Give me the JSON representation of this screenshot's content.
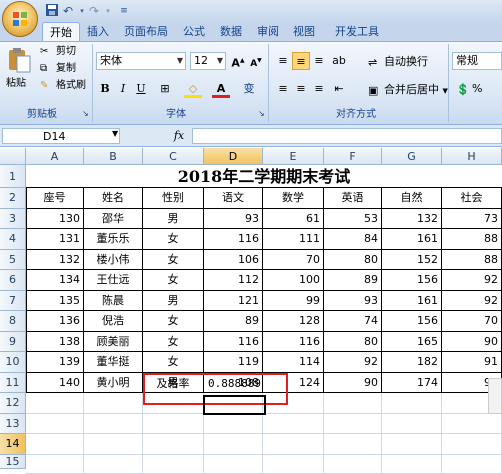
{
  "quick_access": {
    "save_icon": "save-icon",
    "undo_icon": "undo-icon",
    "redo_icon": "redo-icon",
    "more_icon": "customize-icon"
  },
  "tabs": [
    "开始",
    "插入",
    "页面布局",
    "公式",
    "数据",
    "审阅",
    "视图",
    "开发工具"
  ],
  "active_tab": "开始",
  "ribbon": {
    "clipboard": {
      "paste": "粘贴",
      "cut": "剪切",
      "copy": "复制",
      "format_painter": "格式刷",
      "label": "剪贴板"
    },
    "font": {
      "name": "宋体",
      "size": "12",
      "grow": "A",
      "shrink": "A",
      "bold": "B",
      "italic": "I",
      "underline": "U",
      "border": "⊞",
      "fill": "◇",
      "fontcolor": "A",
      "phonetic": "变",
      "label": "字体"
    },
    "alignment": {
      "wrap": "自动换行",
      "merge": "合并后居中",
      "label": "对齐方式"
    },
    "number": {
      "format": "常规",
      "percent": "%"
    }
  },
  "formula_bar": {
    "name_box": "D14",
    "fx": "fx",
    "formula": ""
  },
  "columns": [
    "A",
    "B",
    "C",
    "D",
    "E",
    "F",
    "G",
    "H"
  ],
  "selected_column": "D",
  "rows": [
    "1",
    "2",
    "3",
    "4",
    "5",
    "6",
    "7",
    "8",
    "9",
    "10",
    "11",
    "12",
    "13",
    "14",
    "15"
  ],
  "selected_row": "14",
  "sheet_title": "2018年二学期期末考试",
  "table": {
    "headers": [
      "座号",
      "姓名",
      "性别",
      "语文",
      "数学",
      "英语",
      "自然",
      "社会"
    ],
    "rows": [
      [
        "130",
        "邵华",
        "男",
        "93",
        "61",
        "53",
        "132",
        "73"
      ],
      [
        "131",
        "董乐乐",
        "女",
        "116",
        "111",
        "84",
        "161",
        "88"
      ],
      [
        "132",
        "楼小伟",
        "女",
        "106",
        "70",
        "80",
        "152",
        "88"
      ],
      [
        "134",
        "王仕远",
        "女",
        "112",
        "100",
        "89",
        "156",
        "92"
      ],
      [
        "135",
        "陈晨",
        "男",
        "121",
        "99",
        "93",
        "161",
        "92"
      ],
      [
        "136",
        "倪浩",
        "女",
        "89",
        "128",
        "74",
        "156",
        "70"
      ],
      [
        "138",
        "顾美丽",
        "女",
        "116",
        "116",
        "80",
        "165",
        "90"
      ],
      [
        "139",
        "董华挺",
        "女",
        "119",
        "114",
        "92",
        "182",
        "91"
      ],
      [
        "140",
        "黄小明",
        "男",
        "108",
        "124",
        "90",
        "174",
        "91"
      ]
    ]
  },
  "pass_rate": {
    "label": "及格率",
    "value": "0.888889"
  }
}
